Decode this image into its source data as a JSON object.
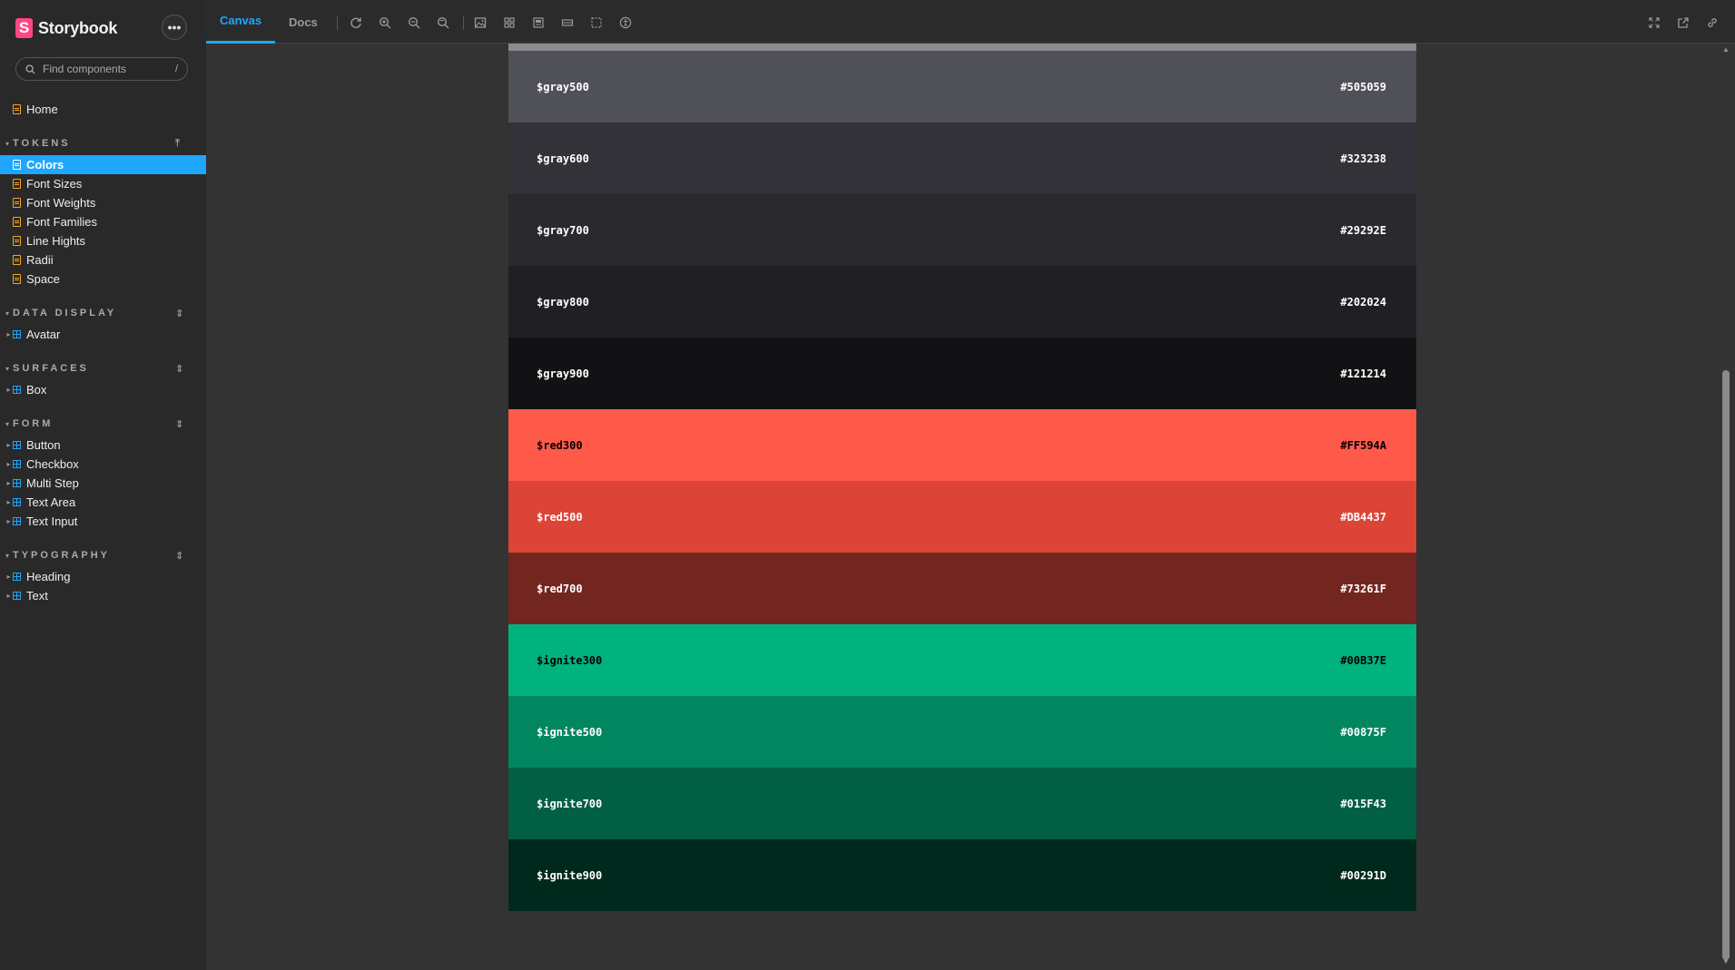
{
  "app": {
    "name": "Storybook",
    "logo_letter": "S",
    "menu_label": "•••"
  },
  "search": {
    "placeholder": "Find components",
    "shortcut": "/"
  },
  "sidebar": {
    "home": "Home",
    "sections": [
      {
        "title": "TOKENS",
        "items": [
          "Colors",
          "Font Sizes",
          "Font Weights",
          "Font Families",
          "Line Hights",
          "Radii",
          "Space"
        ]
      },
      {
        "title": "DATA DISPLAY",
        "items": [
          "Avatar"
        ]
      },
      {
        "title": "SURFACES",
        "items": [
          "Box"
        ]
      },
      {
        "title": "FORM",
        "items": [
          "Button",
          "Checkbox",
          "Multi Step",
          "Text Area",
          "Text Input"
        ]
      },
      {
        "title": "TYPOGRAPHY",
        "items": [
          "Heading",
          "Text"
        ]
      }
    ],
    "active_item": "Colors"
  },
  "toolbar": {
    "tabs": [
      "Canvas",
      "Docs"
    ],
    "active_tab": "Canvas",
    "accent": "#1ea7fd"
  },
  "swatches": [
    {
      "name": "$gray500",
      "hex": "#505059",
      "bg": "#505059",
      "fg": "#ffffff"
    },
    {
      "name": "$gray600",
      "hex": "#323238",
      "bg": "#323238",
      "fg": "#ffffff"
    },
    {
      "name": "$gray700",
      "hex": "#29292E",
      "bg": "#29292E",
      "fg": "#ffffff"
    },
    {
      "name": "$gray800",
      "hex": "#202024",
      "bg": "#202024",
      "fg": "#ffffff"
    },
    {
      "name": "$gray900",
      "hex": "#121214",
      "bg": "#121214",
      "fg": "#ffffff"
    },
    {
      "name": "$red300",
      "hex": "#FF594A",
      "bg": "#FF594A",
      "fg": "#000000"
    },
    {
      "name": "$red500",
      "hex": "#DB4437",
      "bg": "#DB4437",
      "fg": "#ffffff"
    },
    {
      "name": "$red700",
      "hex": "#73261F",
      "bg": "#73261F",
      "fg": "#ffffff"
    },
    {
      "name": "$ignite300",
      "hex": "#00B37E",
      "bg": "#00B37E",
      "fg": "#000000"
    },
    {
      "name": "$ignite500",
      "hex": "#00875F",
      "bg": "#00875F",
      "fg": "#ffffff"
    },
    {
      "name": "$ignite700",
      "hex": "#015F43",
      "bg": "#015F43",
      "fg": "#ffffff"
    },
    {
      "name": "$ignite900",
      "hex": "#00291D",
      "bg": "#00291D",
      "fg": "#ffffff"
    }
  ]
}
